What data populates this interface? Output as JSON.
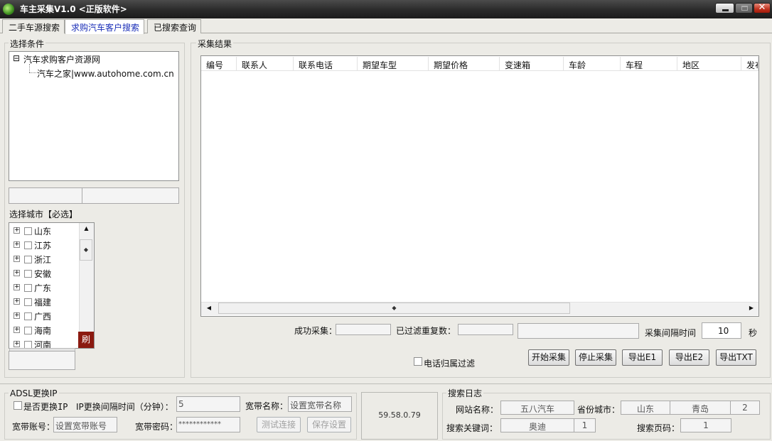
{
  "window": {
    "title": "车主采集V1.0 <正版软件>"
  },
  "tabs": [
    "二手车源搜索",
    "求购汽车客户搜索",
    "已搜索查询"
  ],
  "conditions": {
    "legend": "选择条件",
    "tree_root": "汽车求购客户资源网",
    "tree_child": "汽车之家|www.autohome.com.cn",
    "root_expander": "⊟"
  },
  "city": {
    "legend": "选择城市【必选】",
    "items": [
      "山东",
      "江苏",
      "浙江",
      "安徽",
      "广东",
      "福建",
      "广西",
      "海南",
      "河南"
    ],
    "refresh_label": "刷"
  },
  "results": {
    "legend": "采集结果",
    "columns": [
      "编号",
      "联系人",
      "联系电话",
      "期望车型",
      "期望价格",
      "变速箱",
      "车龄",
      "车程",
      "地区",
      "发布"
    ],
    "rows": [],
    "success_label": "成功采集：",
    "filtered_label": "已过滤重复数：",
    "interval_label": "采集间隔时间",
    "interval_value": "10",
    "interval_unit": "秒",
    "phone_filter_label": "电话归属过滤",
    "buttons": {
      "start": "开始采集",
      "stop": "停止采集",
      "export_e1": "导出E1",
      "export_e2": "导出E2",
      "export_txt": "导出TXT"
    }
  },
  "adsl": {
    "legend": "ADSL更换IP",
    "change_ip_label": "是否更换IP",
    "interval_label": "IP更换间隔时间（分钟）：",
    "interval_value": "5",
    "bb_name_label": "宽带名称：",
    "bb_name_placeholder": "设置宽带名称",
    "account_label": "宽带账号：",
    "account_placeholder": "设置宽带账号",
    "password_label": "宽带密码：",
    "password_value": "************",
    "test_button": "测试连接",
    "save_button": "保存设置"
  },
  "ip_display": "59.58.0.79",
  "search_log": {
    "legend": "搜索日志",
    "site_label": "网站名称：",
    "site_value": "五八汽车",
    "province_label": "省份城市：",
    "province_value": "山东",
    "city_value": "青岛",
    "city_count": "2",
    "keyword_label": "搜索关键词：",
    "keyword_value": "奥迪",
    "keyword_count": "1",
    "page_label": "搜索页码：",
    "page_value": "1"
  },
  "colors": {
    "titlebar": "#2a2a2a",
    "active_tab_text": "#1b2fb8",
    "close_button": "#c0321e",
    "refresh_button": "#8b1a10"
  }
}
